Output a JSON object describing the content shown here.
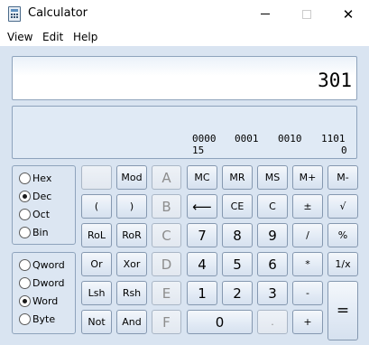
{
  "window": {
    "title": "Calculator",
    "minimize_icon": "minimize-icon",
    "maximize_icon": "maximize-icon",
    "close_icon": "close-icon",
    "close_glyph": "✕"
  },
  "menu": [
    "View",
    "Edit",
    "Help"
  ],
  "display": {
    "value": "301"
  },
  "bits": {
    "groups": [
      "0000",
      "0001",
      "0010",
      "1101"
    ],
    "index_left": "15",
    "index_right": "0"
  },
  "base_options": [
    {
      "label": "Hex",
      "selected": false
    },
    {
      "label": "Dec",
      "selected": true
    },
    {
      "label": "Oct",
      "selected": false
    },
    {
      "label": "Bin",
      "selected": false
    }
  ],
  "word_options": [
    {
      "label": "Qword",
      "selected": false
    },
    {
      "label": "Dword",
      "selected": false
    },
    {
      "label": "Word",
      "selected": true
    },
    {
      "label": "Byte",
      "selected": false
    }
  ],
  "buttons": {
    "blank": "",
    "mod": "Mod",
    "A": "A",
    "B": "B",
    "C": "C",
    "D": "D",
    "E": "E",
    "F": "F",
    "mc": "MC",
    "mr": "MR",
    "ms": "MS",
    "mplus": "M+",
    "mminus": "M-",
    "lparen": "(",
    "rparen": ")",
    "backspace": "⟵",
    "ce": "CE",
    "clear": "C",
    "plusminus": "±",
    "sqrt": "√",
    "rol": "RoL",
    "ror": "RoR",
    "d7": "7",
    "d8": "8",
    "d9": "9",
    "div": "/",
    "pct": "%",
    "or": "Or",
    "xor": "Xor",
    "d4": "4",
    "d5": "5",
    "d6": "6",
    "mul": "*",
    "recip": "1/x",
    "lsh": "Lsh",
    "rsh": "Rsh",
    "d1": "1",
    "d2": "2",
    "d3": "3",
    "minus": "-",
    "equals": "=",
    "not": "Not",
    "and": "And",
    "d0": "0",
    "dot": ".",
    "plus": "+"
  }
}
